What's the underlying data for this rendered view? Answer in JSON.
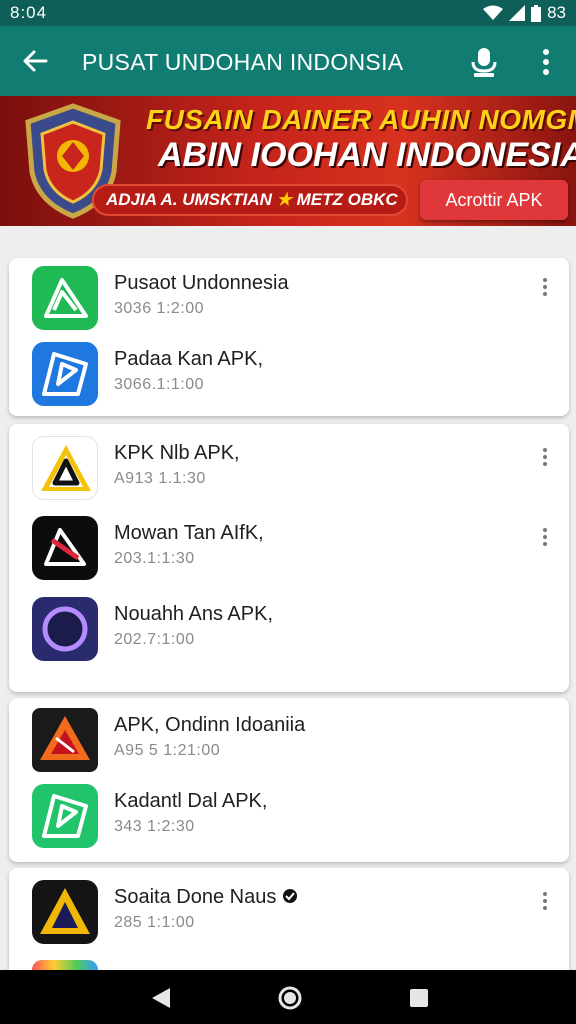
{
  "status": {
    "time": "8:04",
    "battery": "83"
  },
  "appbar": {
    "title": "PUSAT UNDOHAN INDONSIA",
    "back_icon": "arrow-left-icon",
    "mic_icon": "mic-icon",
    "more_icon": "more-vert-icon"
  },
  "banner": {
    "line1": "FUSAIN DAINER AUHIN NOMGMAM",
    "line2": "ABIN IOOHAN INDONESIA!",
    "pill_left": "ADJIA A. UMSKTIAN",
    "pill_right": "METZ OBKC",
    "cta": "Acrottir APK"
  },
  "cards": [
    {
      "items": [
        {
          "name": "Pusaot Undonnesia",
          "sub": "3036 1:2:00",
          "kebab": true
        },
        {
          "name": "Padaa Kan APK,",
          "sub": "3066.1:1:00",
          "kebab": false
        }
      ]
    },
    {
      "items": [
        {
          "name": "KPK Nlb APK,",
          "sub": "A913 1.1:30",
          "kebab": true
        },
        {
          "name": "Mowan Tan AIfK,",
          "sub": "203.1:1:30",
          "kebab": true
        },
        {
          "name": "Nouahh Ans APK,",
          "sub": "202.7:1:00",
          "kebab": false
        }
      ]
    },
    {
      "items": [
        {
          "name": "APK, Ondinn Idoaniia",
          "sub": "A95 5 1:21:00",
          "kebab": false
        },
        {
          "name": "Kadantl Dal APK,",
          "sub": "343 1:2:30",
          "kebab": false
        }
      ]
    },
    {
      "items": [
        {
          "name": "Soaita Done Naus",
          "sub": "285 1:1:00",
          "kebab": true
        }
      ]
    }
  ],
  "colors": {
    "statusbar": "#0d5f57",
    "appbar": "#117d72",
    "banner_red": "#c5241b",
    "cta": "#e0373b"
  }
}
